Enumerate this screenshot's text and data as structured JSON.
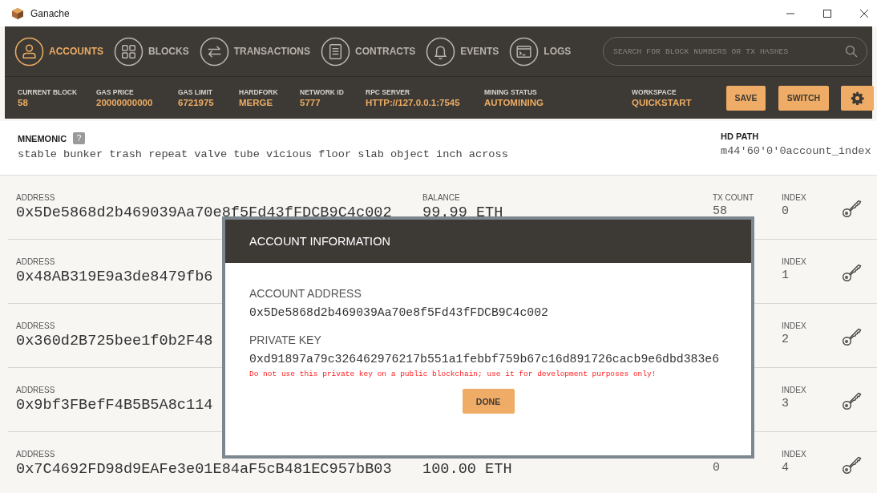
{
  "window": {
    "title": "Ganache"
  },
  "tabs": [
    {
      "label": "ACCOUNTS",
      "selected": true
    },
    {
      "label": "BLOCKS",
      "selected": false
    },
    {
      "label": "TRANSACTIONS",
      "selected": false
    },
    {
      "label": "CONTRACTS",
      "selected": false
    },
    {
      "label": "EVENTS",
      "selected": false
    },
    {
      "label": "LOGS",
      "selected": false
    }
  ],
  "search": {
    "placeholder": "SEARCH FOR BLOCK NUMBERS OR TX HASHES"
  },
  "stats": [
    {
      "label": "CURRENT BLOCK",
      "value": "58"
    },
    {
      "label": "GAS PRICE",
      "value": "20000000000"
    },
    {
      "label": "GAS LIMIT",
      "value": "6721975"
    },
    {
      "label": "HARDFORK",
      "value": "MERGE"
    },
    {
      "label": "NETWORK ID",
      "value": "5777"
    },
    {
      "label": "RPC SERVER",
      "value": "HTTP://127.0.0.1:7545"
    },
    {
      "label": "MINING STATUS",
      "value": "AUTOMINING"
    }
  ],
  "workspace": {
    "label": "WORKSPACE",
    "value": "QUICKSTART"
  },
  "buttons": [
    "SAVE",
    "SWITCH"
  ],
  "mnemonic": {
    "label": "MNEMONIC",
    "help": "?",
    "words": "stable bunker trash repeat valve tube vicious floor slab object inch across"
  },
  "hd_path": {
    "label": "HD PATH",
    "value": "m44'60'0'0account_index"
  },
  "accounts": [
    {
      "address_label": "ADDRESS",
      "address": "0x5De5868d2b469039Aa70e8f5Fd43fFDCB9C4c002",
      "balance_label": "BALANCE",
      "balance": "99.99 ETH",
      "tx_count_label": "TX COUNT",
      "tx_count": "58",
      "index_label": "INDEX",
      "index": "0"
    },
    {
      "address_label": "ADDRESS",
      "address": "0x48AB319E9a3de8479fb6",
      "index_label": "INDEX",
      "index": "1"
    },
    {
      "address_label": "ADDRESS",
      "address": "0x360d2B725bee1f0b2F48",
      "index_label": "INDEX",
      "index": "2"
    },
    {
      "address_label": "ADDRESS",
      "address": "0x9bf3FBefF4B5B5A8c114",
      "index_label": "INDEX",
      "index": "3"
    },
    {
      "address_label": "ADDRESS",
      "address": "0x7C4692FD98d9EAFe3e01E84aF5cB481EC957bB03",
      "balance": "100.00 ETH",
      "tx_count": "0",
      "index_label": "INDEX",
      "index": "4"
    }
  ],
  "dialog": {
    "title": "ACCOUNT INFORMATION",
    "address_label": "ACCOUNT ADDRESS",
    "address": "0x5De5868d2b469039Aa70e8f5Fd43fFDCB9C4c002",
    "key_label": "PRIVATE KEY",
    "private_key": "0xd91897a79c326462976217b551a1febbf759b67c16d891726cacb9e6dbd383e6",
    "warning": "Do not use this private key on a public blockchain; use it for development purposes only!",
    "button": "DONE"
  }
}
